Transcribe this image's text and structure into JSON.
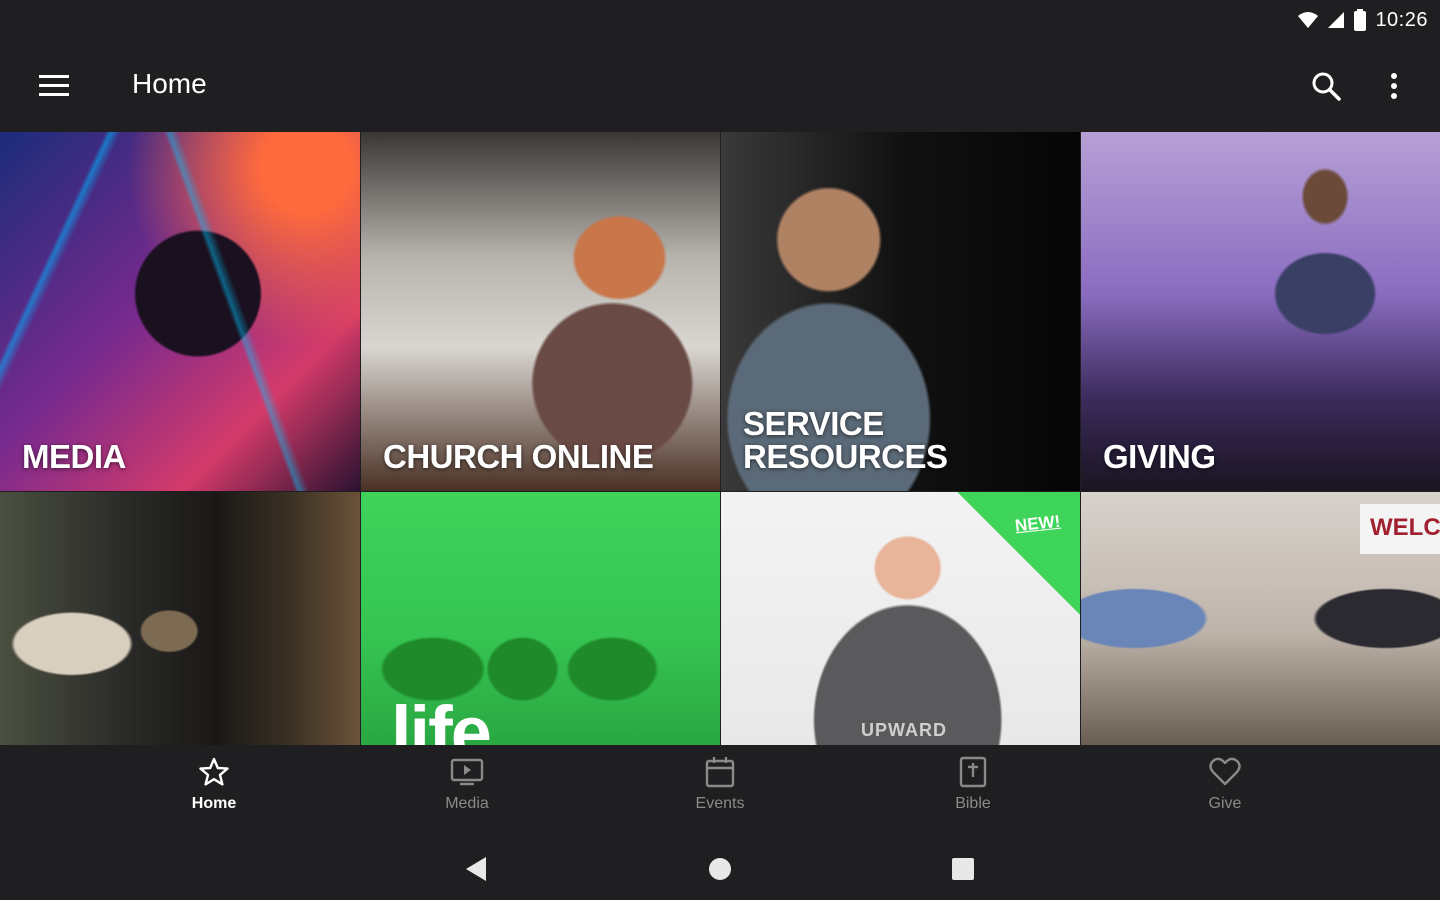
{
  "status": {
    "time": "10:26"
  },
  "header": {
    "title": "Home"
  },
  "tiles": [
    {
      "label_lines": [
        "MEDIA"
      ]
    },
    {
      "label_lines": [
        "CHURCH ONLINE"
      ]
    },
    {
      "label_lines": [
        "SERVICE",
        "RESOURCES"
      ]
    },
    {
      "label_lines": [
        "GIVING"
      ]
    },
    {
      "label_lines": []
    },
    {
      "label_lines": [],
      "overlay_text": "life"
    },
    {
      "label_lines": [],
      "badge": "NEW!",
      "shirt_text": "UPWARD"
    },
    {
      "label_lines": [],
      "sign_text": "WELCO"
    }
  ],
  "bottom_nav": [
    {
      "label": "Home",
      "icon": "star-icon",
      "active": true
    },
    {
      "label": "Media",
      "icon": "tv-icon",
      "active": false
    },
    {
      "label": "Events",
      "icon": "calendar-icon",
      "active": false
    },
    {
      "label": "Bible",
      "icon": "bible-icon",
      "active": false
    },
    {
      "label": "Give",
      "icon": "heart-icon",
      "active": false
    }
  ],
  "colors": {
    "background": "#1f1f21",
    "active": "#ffffff",
    "inactive": "#8a8a8a",
    "accent_green": "#3ed35a"
  }
}
